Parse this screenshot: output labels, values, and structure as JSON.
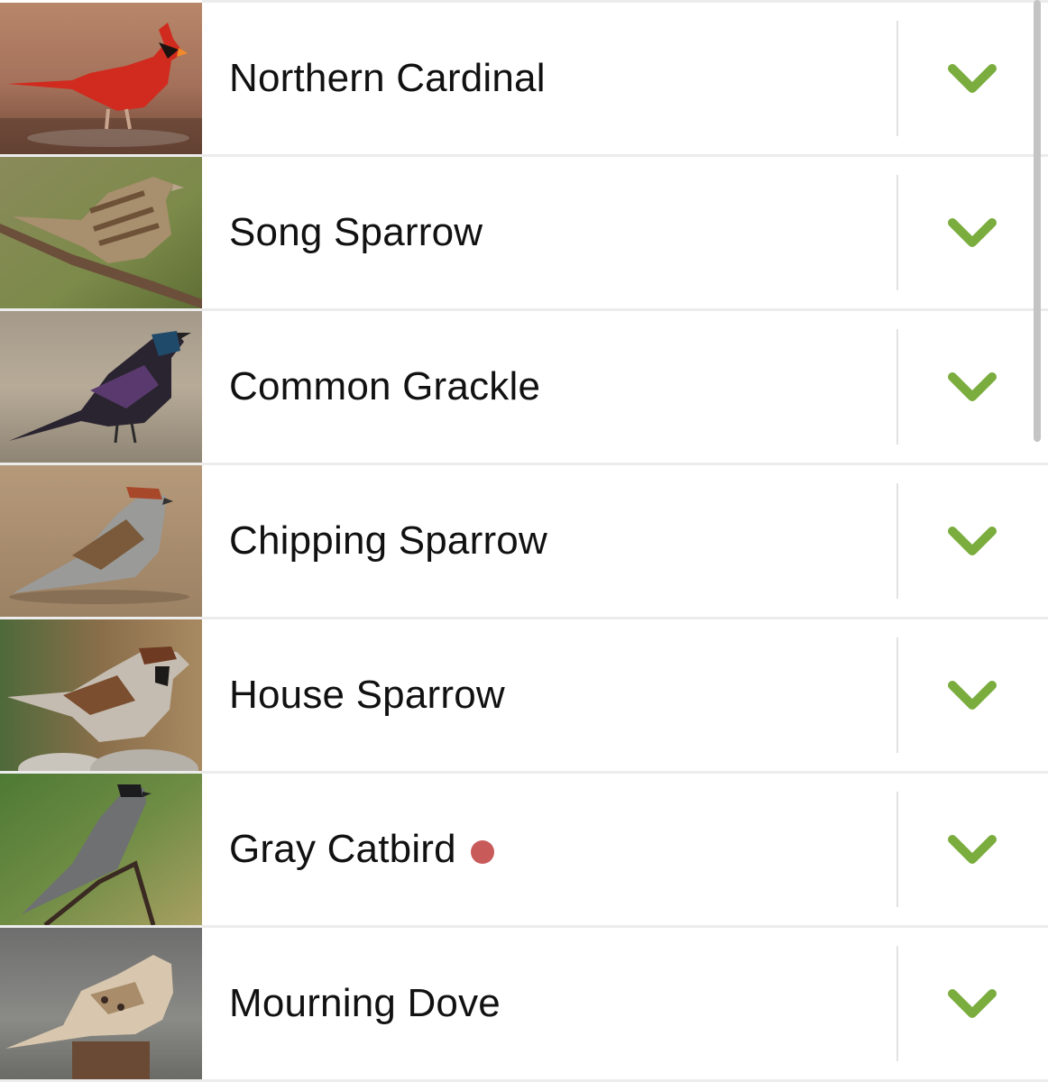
{
  "birds": [
    {
      "name": "Northern Cardinal",
      "icon": "northern-cardinal-photo",
      "new_badge": false
    },
    {
      "name": "Song Sparrow",
      "icon": "song-sparrow-photo",
      "new_badge": false
    },
    {
      "name": "Common Grackle",
      "icon": "common-grackle-photo",
      "new_badge": false
    },
    {
      "name": "Chipping Sparrow",
      "icon": "chipping-sparrow-photo",
      "new_badge": false
    },
    {
      "name": "House Sparrow",
      "icon": "house-sparrow-photo",
      "new_badge": false
    },
    {
      "name": "Gray Catbird",
      "icon": "gray-catbird-photo",
      "new_badge": true
    },
    {
      "name": "Mourning Dove",
      "icon": "mourning-dove-photo",
      "new_badge": false
    }
  ],
  "expand_icon": "chevron-down-icon",
  "colors": {
    "chevron": "#7aac3e",
    "badge_dot": "#c85a5a",
    "text": "#111111",
    "divider": "#e2e2e2"
  }
}
